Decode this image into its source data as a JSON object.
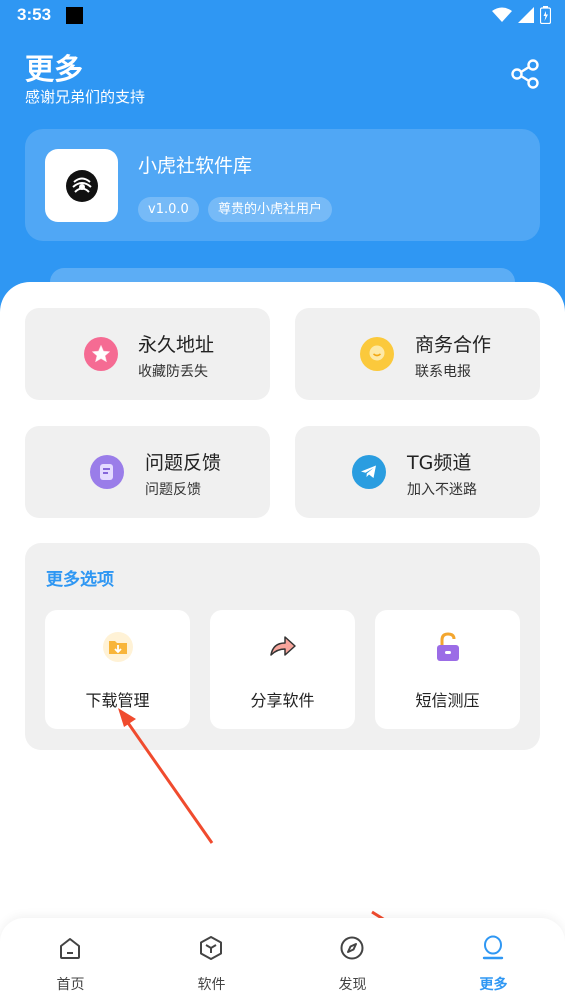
{
  "status_bar": {
    "time": "3:53"
  },
  "header": {
    "title": "更多",
    "subtitle": "感谢兄弟们的支持"
  },
  "profile": {
    "app_name": "小虎社软件库",
    "version": "v1.0.0",
    "user_badge": "尊贵的小虎社用户"
  },
  "tiles": [
    {
      "title": "永久地址",
      "subtitle": "收藏防丢失",
      "icon": "star-icon"
    },
    {
      "title": "商务合作",
      "subtitle": "联系电报",
      "icon": "chat-bubble-icon"
    },
    {
      "title": "问题反馈",
      "subtitle": "问题反馈",
      "icon": "feedback-icon"
    },
    {
      "title": "TG频道",
      "subtitle": "加入不迷路",
      "icon": "telegram-icon"
    }
  ],
  "more_options": {
    "title": "更多选项",
    "items": [
      {
        "label": "下载管理",
        "icon": "download-folder-icon"
      },
      {
        "label": "分享软件",
        "icon": "share-arrow-icon"
      },
      {
        "label": "短信测压",
        "icon": "unlock-icon"
      }
    ]
  },
  "tabbar": {
    "items": [
      {
        "label": "首页",
        "icon": "home-icon"
      },
      {
        "label": "软件",
        "icon": "cube-icon"
      },
      {
        "label": "发现",
        "icon": "compass-icon"
      },
      {
        "label": "更多",
        "icon": "user-icon",
        "active": true
      }
    ]
  },
  "colors": {
    "primary": "#2f97f3",
    "annotation_arrow": "#f04b2e",
    "tile_bg": "#f0f0f0"
  }
}
